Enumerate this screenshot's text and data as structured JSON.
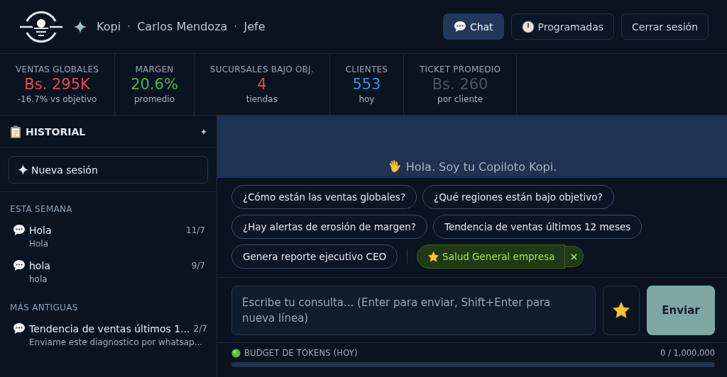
{
  "header": {
    "brand": "Kopi",
    "sep_1": "·",
    "user": "Carlos Mendoza",
    "sep_2": "·",
    "role": "Jefe",
    "nav": [
      {
        "label": "Chat",
        "kind": "chat",
        "selected": true
      },
      {
        "label": "Programadas",
        "kind": "schedule",
        "selected": false
      },
      {
        "label": "Cerrar sesión",
        "kind": "logout",
        "selected": false
      }
    ]
  },
  "kpis": [
    {
      "label": "VENTAS GLOBALES",
      "value": "Bs. 295K",
      "sub": "-16.7% vs objetivo",
      "color": "#e5484d"
    },
    {
      "label": "MARGEN",
      "value": "20.6%",
      "sub": "promedio",
      "color": "#3fb950"
    },
    {
      "label": "SUCURSALES BAJO OBJ.",
      "value": "4",
      "sub": "tiendas",
      "color": "#e5484d"
    },
    {
      "label": "CLIENTES",
      "value": "553",
      "sub": "hoy",
      "color": "#3b8ee6"
    },
    {
      "label": "TICKET PROMEDIO",
      "value": "Bs. 260",
      "sub": "por cliente",
      "color": "#4a5564"
    }
  ],
  "sidebar": {
    "title": "HISTORIAL",
    "new_session": "Nueva sesión",
    "groups": [
      {
        "label": "ESTA SEMANA",
        "items": [
          {
            "title": "Hola",
            "preview": "Hola",
            "date": "11/7"
          },
          {
            "title": "hola",
            "preview": "hola",
            "date": "9/7"
          }
        ]
      },
      {
        "label": "MÁS ANTIGUAS",
        "items": [
          {
            "title": "Tendencia de ventas últimos 1...",
            "preview": "Enviame este diagnostico por whatsap...",
            "date": "2/7"
          }
        ]
      }
    ]
  },
  "chat": {
    "greeting": "Hola. Soy tu Copiloto Kopi.",
    "suggestions": [
      {
        "label": "¿Cómo están las ventas globales?",
        "kind": "suggestion"
      },
      {
        "label": "¿Qué regiones están bajo objetivo?",
        "kind": "suggestion"
      },
      {
        "label": "¿Hay alertas de erosión de margen?",
        "kind": "suggestion"
      },
      {
        "label": "Tendencia de ventas últimos 12 meses",
        "kind": "suggestion"
      },
      {
        "label": "Genera reporte ejecutivo CEO",
        "kind": "suggestion"
      },
      {
        "label": "Salud General empresa",
        "kind": "favorite"
      }
    ],
    "input": {
      "placeholder": "Escribe tu consulta... (Enter para enviar, Shift+Enter para nueva línea)"
    },
    "send": "Enviar"
  },
  "budget": {
    "label": "BUDGET DE TOKENS (HOY)",
    "reading": "0 / 1,000,000",
    "level": 0
  }
}
